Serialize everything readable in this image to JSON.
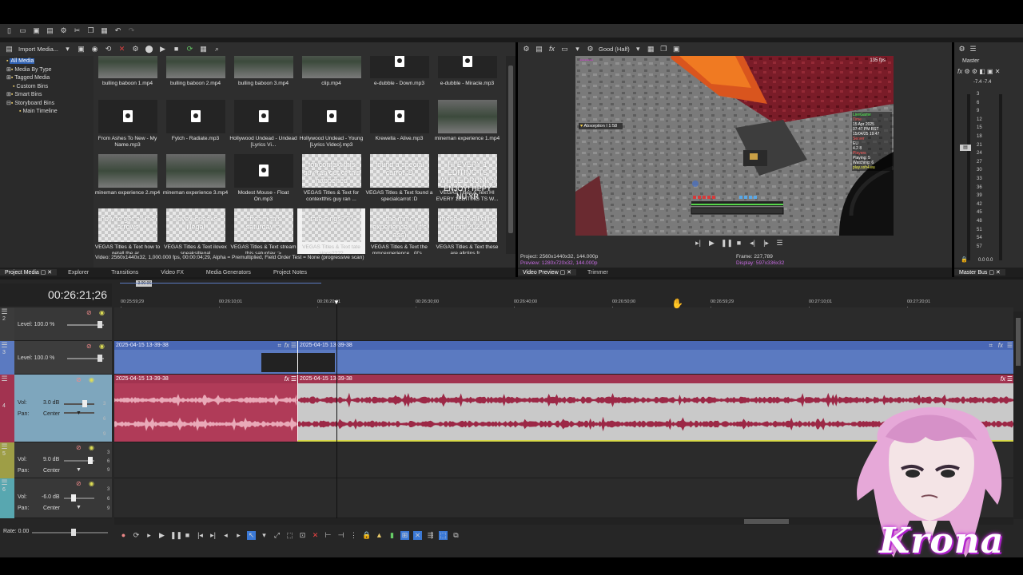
{
  "app": {
    "toolbar_icons": [
      "new-icon",
      "open-icon",
      "save-icon",
      "save-as-icon",
      "properties-icon",
      "cut-icon",
      "copy-icon",
      "paste-icon",
      "undo-icon",
      "redo-icon"
    ]
  },
  "project_media": {
    "import_label": "Import Media...",
    "tree": [
      "All Media",
      "Media By Type",
      "Tagged Media",
      "Custom Bins",
      "Smart Bins",
      "Storyboard Bins",
      "Main Timeline"
    ],
    "items": [
      {
        "label": "bulling baboon 1.mp4",
        "kind": "video"
      },
      {
        "label": "bulling baboon 2.mp4",
        "kind": "video"
      },
      {
        "label": "bulling baboon 3.mp4",
        "kind": "video"
      },
      {
        "label": "clip.mp4",
        "kind": "video"
      },
      {
        "label": "e-dubble - Down.mp3",
        "kind": "audio"
      },
      {
        "label": "e-dubble - Miracle.mp3",
        "kind": "audio"
      },
      {
        "label": "From Ashes To New - My Name.mp3",
        "kind": "audio"
      },
      {
        "label": "Fytch - Radiate.mp3",
        "kind": "audio"
      },
      {
        "label": "Hollywood Undead - Undead [Lyrics Vi...",
        "kind": "audio"
      },
      {
        "label": "Hollywood Undead - Young [Lyrics Video].mp3",
        "kind": "audio"
      },
      {
        "label": "Krewella - Alive.mp3",
        "kind": "audio"
      },
      {
        "label": "mineman experience 1.mp4",
        "kind": "video"
      },
      {
        "label": "mineman experience 2.mp4",
        "kind": "video"
      },
      {
        "label": "mineman experience 3.mp4",
        "kind": "video"
      },
      {
        "label": "Modest Mouse - Float On.mp3",
        "kind": "audio"
      },
      {
        "label": "VEGAS Titles & Text for contextthis guy ran ...",
        "kind": "title",
        "thumb": "for context this guy ran out of this happened"
      },
      {
        "label": "VEGAS Titles & Text found a specialcarrot :D",
        "kind": "title",
        "thumb": "found a special carrot :D"
      },
      {
        "label": "VEGAS Titles & Text HI EVERY 1EDITING TS W...",
        "kind": "title",
        "thumb": "HI EVERY 1 EDITING TS WHILE DRUNK :) ENJOY! HPPY NU YR"
      },
      {
        "label": "VEGAS Titles & Text how to getall the ar...",
        "kind": "title",
        "thumb": "how to get all the arrows"
      },
      {
        "label": "VEGAS Titles & Text ilovex speaksillegal",
        "kind": "title",
        "thumb": "ilovex speaks illegal"
      },
      {
        "label": "VEGAS Titles & Text stream this saturday :>",
        "kind": "title",
        "thumb": "stream this saturday :>"
      },
      {
        "label": "VEGAS Titles & Text tate sings????",
        "kind": "title",
        "thumb": "tate sings???",
        "selected": true
      },
      {
        "label": "VEGAS Titles & Text the mmcexperience...(it's...",
        "kind": "title",
        "thumb": "the mmc experience... (it's ass)"
      },
      {
        "label": "VEGAS Titles & Text these are allclips fr...",
        "kind": "title",
        "thumb": "these are all clips from 2023"
      }
    ],
    "info": "Video: 2560x1440x32, 1,000.000 fps, 00:00:04;29, Alpha = Premultiplied, Field Order Test = None (progressive scan)"
  },
  "lower_tabs": [
    "Project Media",
    "Explorer",
    "Transitions",
    "Video FX",
    "Media Generators",
    "Project Notes"
  ],
  "preview": {
    "quality": "Good (Half)",
    "overlay": {
      "fps": "135 fps",
      "absorption": "Absorption I 1:58",
      "hud_right": [
        "LiveGame",
        "Time",
        "15 Apr 2025",
        "07:47 PM BST",
        "15/04/25 19:47",
        "Server",
        "EU",
        "4.2.8",
        "Players",
        "Playing: 5",
        "Watching: 6",
        "play.ssh4.eu"
      ]
    },
    "project": "Project:  2560x1440x32, 144.000p",
    "preview": "Preview:  1280x720x32, 144.000p",
    "frame": "Frame:  227,789",
    "display": "Display:  597x336x32",
    "tabs": [
      "Video Preview",
      "Trimmer"
    ]
  },
  "master": {
    "title": "Master",
    "levels": "-7.4    -7.4",
    "scale": [
      "3",
      "6",
      "9",
      "12",
      "15",
      "18",
      "21",
      "24",
      "27",
      "30",
      "33",
      "36",
      "39",
      "42",
      "45",
      "48",
      "51",
      "54",
      "57"
    ],
    "bottom": "0.0    0.0",
    "tab": "Master Bus"
  },
  "timeline": {
    "time": "00:26:21;26",
    "marker": "-3.00.06",
    "ruler": [
      "00:25:59;29",
      "00:26:10;01",
      "00:26:20;01",
      "00:26:30;00",
      "00:26:40;00",
      "00:26:50;00",
      "00:26:59;29",
      "00:27:10;01",
      "00:27:20;01"
    ],
    "tracks": [
      {
        "num": "2",
        "level": "Level: 100.0 %"
      },
      {
        "num": "3",
        "level": "Level: 100.0 %",
        "clips": [
          "2025-04-15 13-39-38",
          "2025-04-15 13-39-38"
        ]
      },
      {
        "num": "4",
        "vol": "3.0 dB",
        "pan": "Center",
        "clips": [
          "2025-04-15 13-39-38",
          "2025-04-15 13-39-38"
        ]
      },
      {
        "num": "5",
        "vol": "9.0 dB",
        "pan": "Center"
      },
      {
        "num": "6",
        "vol": "-6.0 dB",
        "pan": "Center"
      }
    ],
    "vol_label": "Vol:",
    "pan_label": "Pan:",
    "rate": "Rate: 0.00"
  },
  "overlay_text": "Krona",
  "colors": {
    "video_clip": "#5b7ac1",
    "audio_clip_header": "#a23350",
    "audio_wave": "#9c2846",
    "track4_head": "#7ea6bd"
  }
}
